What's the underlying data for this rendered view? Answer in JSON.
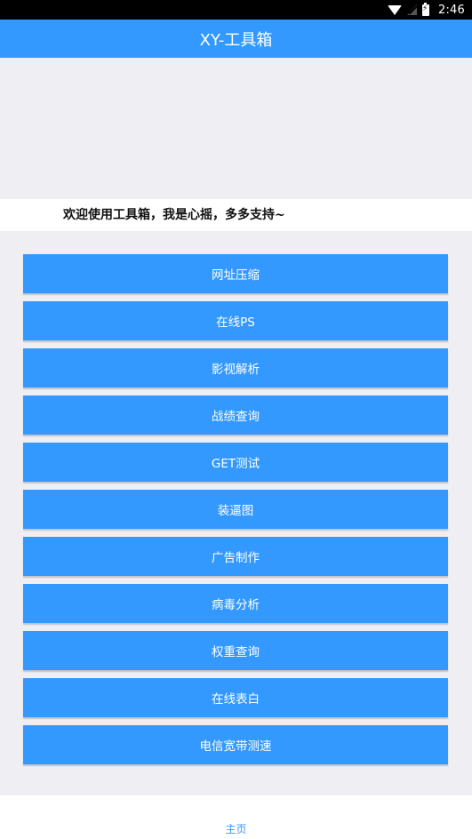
{
  "status_bar": {
    "time": "2:46",
    "icons": [
      "wifi-icon",
      "no-sim-icon",
      "battery-charging-icon"
    ]
  },
  "app_bar": {
    "title": "XY-工具箱"
  },
  "marquee": {
    "text": "欢迎使用工具箱，我是心摇，多多支持~"
  },
  "tools": [
    {
      "label": "网址压缩"
    },
    {
      "label": "在线PS"
    },
    {
      "label": "影视解析"
    },
    {
      "label": "战绩查询"
    },
    {
      "label": "GET测试"
    },
    {
      "label": "装逼图"
    },
    {
      "label": "广告制作"
    },
    {
      "label": "病毒分析"
    },
    {
      "label": "权重查询"
    },
    {
      "label": "在线表白"
    },
    {
      "label": "电信宽带测速"
    }
  ],
  "bottom_nav": {
    "home_label": "主页"
  },
  "colors": {
    "accent": "#3399ff",
    "background": "#efeef3"
  }
}
